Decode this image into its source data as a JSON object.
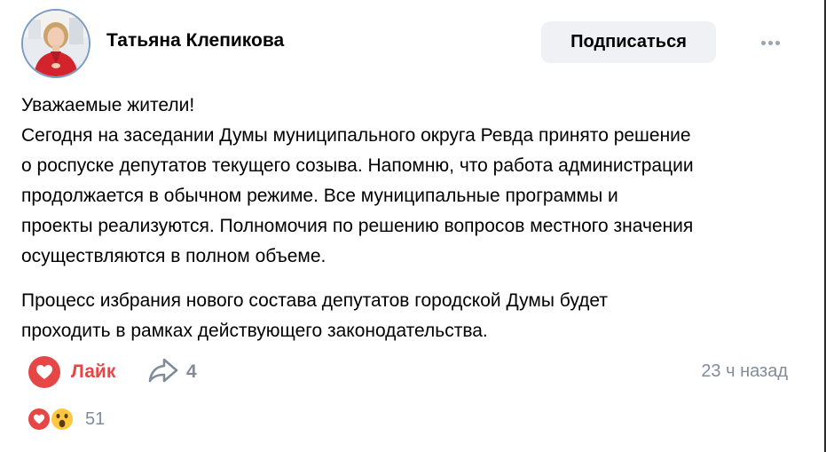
{
  "author": {
    "name": "Татьяна Клепикова"
  },
  "header": {
    "subscribe_label": "Подписаться"
  },
  "post": {
    "lines_p1": [
      "Уважаемые жители!",
      "Сегодня на заседании Думы муниципального округа Ревда принято решение",
      "о роспуске депутатов текущего созыва. Напомню, что работа администрации",
      "продолжается в обычном режиме. Все муниципальные программы и",
      "проекты реализуются. Полномочия по решению вопросов местного значения",
      "осуществляются в полном объеме."
    ],
    "lines_p2": [
      "Процесс избрания нового состава депутатов городской Думы будет",
      "проходить в рамках действующего законодательства."
    ]
  },
  "actions": {
    "like_label": "Лайк",
    "share_count": "4",
    "timestamp": "23 ч назад"
  },
  "reactions": {
    "count": "51",
    "icons": [
      "heart-icon",
      "wow-emoji-icon"
    ]
  },
  "colors": {
    "accent_like": "#e64646",
    "muted": "#818c99",
    "button_bg": "#eff1f4"
  }
}
